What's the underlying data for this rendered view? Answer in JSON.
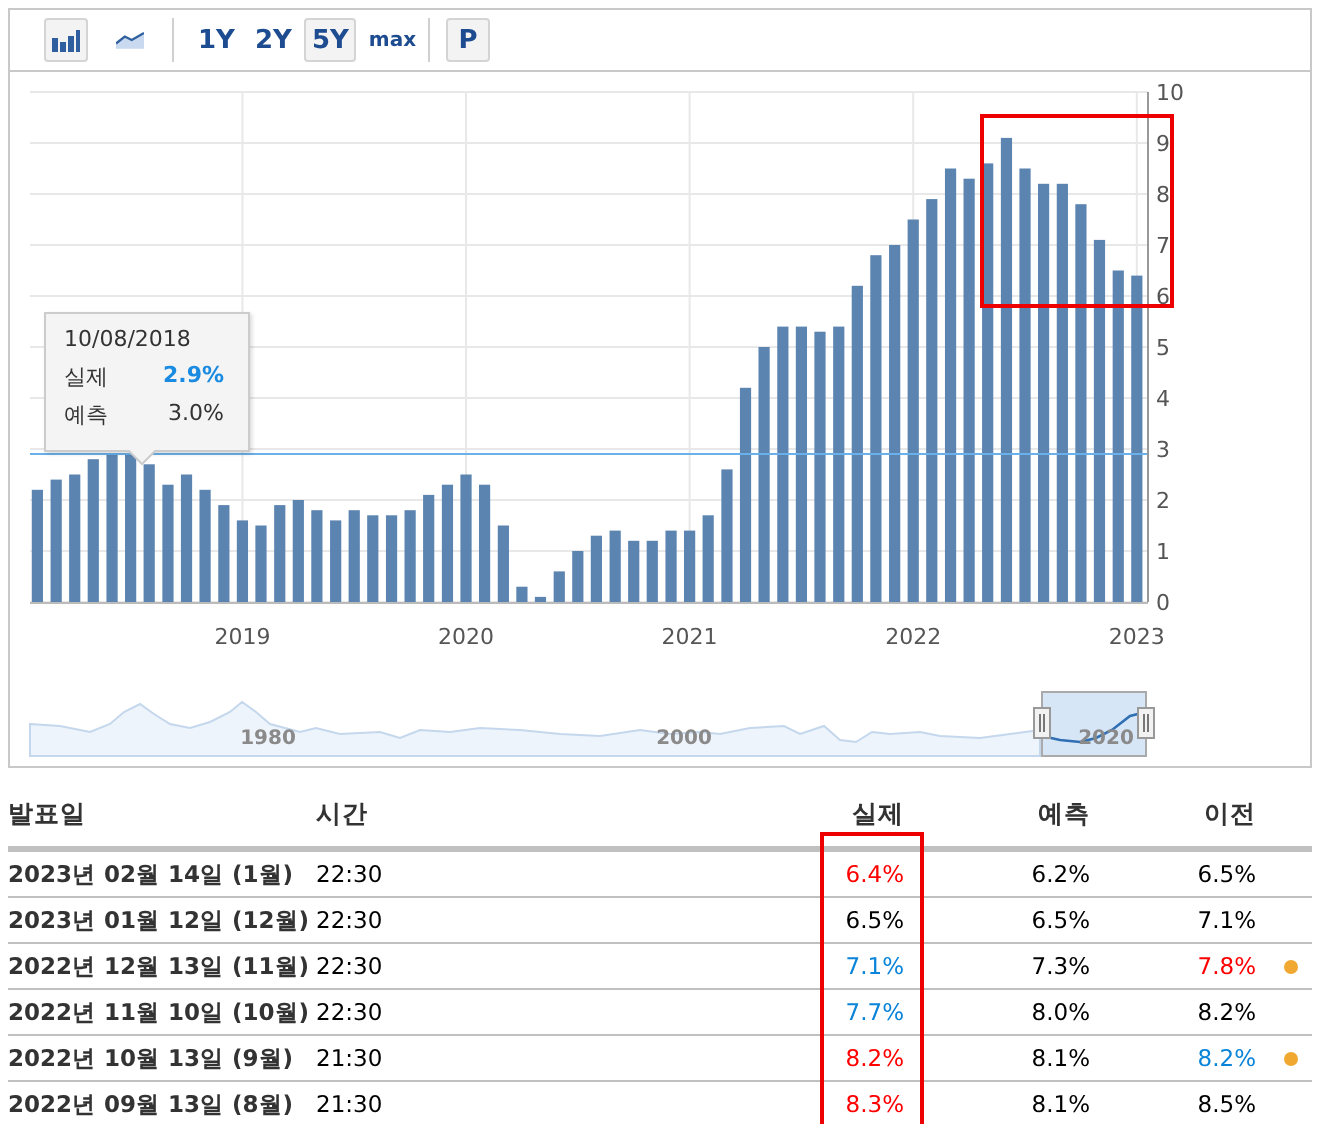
{
  "toolbar": {
    "chart_types": [
      {
        "kind": "bar",
        "selected": true
      },
      {
        "kind": "line",
        "selected": false
      }
    ],
    "ranges": [
      {
        "label": "1Y",
        "selected": false
      },
      {
        "label": "2Y",
        "selected": false
      },
      {
        "label": "5Y",
        "selected": true
      },
      {
        "label": "max",
        "selected": false
      }
    ],
    "extra_button": "P"
  },
  "chart": {
    "highlight_frame": true,
    "chart_data": {
      "type": "bar",
      "grid": true,
      "x": [
        2018.083,
        2018.167,
        2018.25,
        2018.333,
        2018.417,
        2018.5,
        2018.583,
        2018.667,
        2018.75,
        2018.833,
        2018.917,
        2019.0,
        2019.083,
        2019.167,
        2019.25,
        2019.333,
        2019.417,
        2019.5,
        2019.583,
        2019.667,
        2019.75,
        2019.833,
        2019.917,
        2020.0,
        2020.083,
        2020.167,
        2020.25,
        2020.333,
        2020.417,
        2020.5,
        2020.583,
        2020.667,
        2020.75,
        2020.833,
        2020.917,
        2021.0,
        2021.083,
        2021.167,
        2021.25,
        2021.333,
        2021.417,
        2021.5,
        2021.583,
        2021.667,
        2021.75,
        2021.833,
        2021.917,
        2022.0,
        2022.083,
        2022.167,
        2022.25,
        2022.333,
        2022.417,
        2022.5,
        2022.583,
        2022.667,
        2022.75,
        2022.833,
        2022.917,
        2023.0
      ],
      "series": [
        {
          "color": "#5b84b1",
          "values": [
            2.2,
            2.4,
            2.5,
            2.8,
            2.9,
            2.9,
            2.7,
            2.3,
            2.5,
            2.2,
            1.9,
            1.6,
            1.5,
            1.9,
            2.0,
            1.8,
            1.6,
            1.8,
            1.7,
            1.7,
            1.8,
            2.1,
            2.3,
            2.5,
            2.3,
            1.5,
            0.3,
            0.1,
            0.6,
            1.0,
            1.3,
            1.4,
            1.2,
            1.2,
            1.4,
            1.4,
            1.7,
            2.6,
            4.2,
            5.0,
            5.4,
            5.4,
            5.3,
            5.4,
            6.2,
            6.8,
            7.0,
            7.5,
            7.9,
            8.5,
            8.3,
            8.6,
            9.1,
            8.5,
            8.2,
            8.2,
            7.8,
            7.1,
            6.5,
            6.4
          ]
        }
      ],
      "ylim": [
        0,
        10
      ],
      "yticks": [
        0,
        1,
        2,
        3,
        4,
        5,
        6,
        7,
        8,
        9,
        10
      ],
      "xlim": [
        2018.05,
        2023.05
      ],
      "xticks": [
        2019,
        2020,
        2021,
        2022,
        2023
      ],
      "ref_lines": [
        {
          "axis": "y",
          "value": 2.9
        }
      ]
    },
    "tooltip": {
      "date": "10/08/2018",
      "rows": [
        {
          "label": "실제",
          "value": "2.9%",
          "kind": "actual"
        },
        {
          "label": "예측",
          "value": "3.0%",
          "kind": "forecast"
        }
      ]
    }
  },
  "navigator": {
    "labels": [
      "1980",
      "2000",
      "2020"
    ]
  },
  "table": {
    "columns": [
      "발표일",
      "시간",
      "실제",
      "예측",
      "이전"
    ],
    "highlight_column": true,
    "rows": [
      {
        "date": "2023년 02월 14일 (1월)",
        "time": "22:30",
        "actual": {
          "text": "6.4%",
          "color": "#ff0000"
        },
        "forecast": "6.2%",
        "previous": {
          "text": "6.5%",
          "color": "#000000",
          "revised": false
        }
      },
      {
        "date": "2023년 01월 12일 (12월)",
        "time": "22:30",
        "actual": {
          "text": "6.5%",
          "color": "#000000"
        },
        "forecast": "6.5%",
        "previous": {
          "text": "7.1%",
          "color": "#000000",
          "revised": false
        }
      },
      {
        "date": "2022년 12월 13일 (11월)",
        "time": "22:30",
        "actual": {
          "text": "7.1%",
          "color": "#0a84d8"
        },
        "forecast": "7.3%",
        "previous": {
          "text": "7.8%",
          "color": "#ff0000",
          "revised": true
        }
      },
      {
        "date": "2022년 11월 10일 (10월)",
        "time": "22:30",
        "actual": {
          "text": "7.7%",
          "color": "#0a84d8"
        },
        "forecast": "8.0%",
        "previous": {
          "text": "8.2%",
          "color": "#000000",
          "revised": false
        }
      },
      {
        "date": "2022년 10월 13일 (9월)",
        "time": "21:30",
        "actual": {
          "text": "8.2%",
          "color": "#ff0000"
        },
        "forecast": "8.1%",
        "previous": {
          "text": "8.2%",
          "color": "#0a84d8",
          "revised": true
        }
      },
      {
        "date": "2022년 09월 13일 (8월)",
        "time": "21:30",
        "actual": {
          "text": "8.3%",
          "color": "#ff0000"
        },
        "forecast": "8.1%",
        "previous": {
          "text": "8.5%",
          "color": "#000000",
          "revised": false
        }
      }
    ]
  }
}
